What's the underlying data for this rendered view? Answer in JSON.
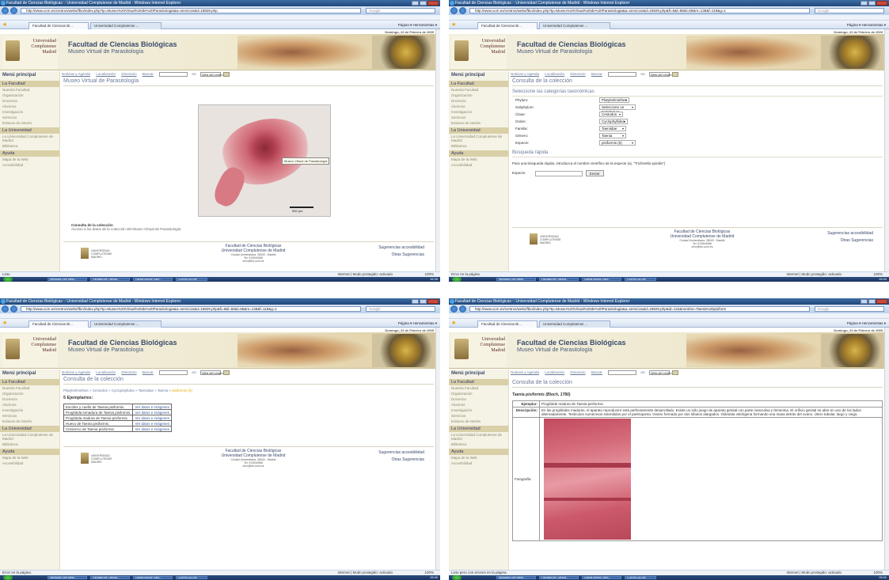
{
  "browser": {
    "window_title": "Facultad de Ciencias Biológicas :: Universidad Complutense de Madrid - Windows Internet Explorer",
    "search_placeholder": "Google",
    "tab1": "Facultad de Ciencias Bi...",
    "tab2": "Universidad Complutense ...",
    "cmd": "Página ▾  Herramientas ▾",
    "taskbar": [
      "Windows Live Mess...",
      "Facultad de Ciencia...",
      "Garcia Muñoz Garc...",
      "CURRICULUM"
    ]
  },
  "quadrants": [
    {
      "url": "http://www.ucm.es/centros/webs/fbio/index.php?tp=Museo%20Virtual%20de%20Parasitologia&a=servicios&d=18828.php",
      "status": "Listo",
      "zone": "Internet | Modo protegido: activado",
      "zoom": "100%",
      "clock": "15:39"
    },
    {
      "url": "http://www.ucm.es/centros/webs/fbio/index.php?tp=Museo%20Virtual%20de%20Parasitologia&a=servicios&d=18829.php&fi=8&l=58&l=68&m=138&f=118&g=1",
      "status": "Error en la página.",
      "zone": "Internet | Modo protegido: activado",
      "zoom": "100%",
      "clock": "15:40"
    },
    {
      "url": "http://www.ucm.es/centros/webs/fbio/index.php?tp=Museo%20Virtual%20de%20Parasitologia&a=servicios&d=18829.php&fi=8&l=58&l=68&m=138&f=118&g=1",
      "status": "Error en la página.",
      "zone": "Internet | Modo protegido: activado",
      "zoom": "100%",
      "clock": "15:40"
    },
    {
      "url": "http://www.ucm.es/centros/webs/fbio/index.php?tp=Museo%20Virtual%20de%20Parasitologia&a=servicios&d=18829.php&id=134&nombre=Taenia%20pisiform",
      "status": "Listo pero con errores en la página.",
      "zone": "Internet | Modo protegido: activado",
      "zoom": "100%",
      "clock": "15:41"
    }
  ],
  "site": {
    "date": "Domingo, 22 de Febrero de 2009",
    "university": "Universidad Complutense Madrid",
    "faculty": "Facultad de Ciencias Biológicas",
    "museum": "Museo Virtual de Parasitología",
    "subnav": [
      "Noticias y Agenda",
      "Localización",
      "Directorio",
      "Buscar"
    ],
    "subnav_scope": "en:",
    "subnav_select": "Web del centro ▾",
    "sidebar": {
      "title": "Menú principal",
      "sections": [
        {
          "name": "La Facultad",
          "items": [
            "Nuestra Facultad",
            "Organización",
            "Docencia",
            "Alumnos",
            "Investigación",
            "Servicios",
            "Enlaces de interés"
          ]
        },
        {
          "name": "La Universidad",
          "items": [
            "La Universidad Complutense de Madrid",
            "Biblioteca"
          ]
        },
        {
          "name": "Ayuda",
          "items": [
            "Mapa de la Web",
            "Accesibilidad"
          ]
        }
      ]
    },
    "footer": {
      "logo": "UNIVERSIDAD COMPLUTENSE MADRID",
      "l1": "Facultad de Ciencias Biológicas",
      "l2": "Universidad Complutense de Madrid",
      "l3": "Ciudad Universitaria. 28040 - Madrid",
      "l4": "Tel. 913944966",
      "l5": "cfco@bio.ucm.es",
      "right1": "Sugerencias accesibilidad",
      "right2": "Otras Sugerencias"
    }
  },
  "page1": {
    "heading": "Museo Virtual de Parasitología",
    "tooltip": "Museo Virtual de Parasitología",
    "scale": "500 µm",
    "consulta_title": "Consulta de la colección",
    "consulta_text": "Acceso a los datos de la colección del Museo Virtual de Parasitología"
  },
  "page2": {
    "heading": "Consulta de la colección",
    "sub": "Seleccione las categorías taxonómicas",
    "fields": [
      {
        "label": "Phylum:",
        "value": "Platyhelminthes"
      },
      {
        "label": "Subphylum:",
        "value": "Seleccione un Subphylum"
      },
      {
        "label": "Clase:",
        "value": "Cestodos"
      },
      {
        "label": "Orden:",
        "value": "Cyclophyllidea"
      },
      {
        "label": "Familia:",
        "value": "Taeniidae"
      },
      {
        "label": "Género:",
        "value": "Taenia"
      },
      {
        "label": "Especie:",
        "value": "pisiformis (5)"
      }
    ],
    "quick_title": "Búsqueda rápida",
    "quick_text": "Para una búsqueda rápida, introduzca el nombre científico de la especie (ej. \"Trichinella spiralis\")",
    "quick_label": "Especie:",
    "quick_button": "Enviar"
  },
  "page3": {
    "heading": "Consulta de la colección",
    "crumbs": "Platyhelminthes » Cestodos » Cyclophyllidea » Taeniidae » Taenia » ",
    "crumbs_last": "pisiformis (5)",
    "count": "5 Ejemplar/es:",
    "rows": [
      {
        "name": "Escólex y cuello de Taenia pisiformis.",
        "link": "Ver datos e imágenes"
      },
      {
        "name": "Proglótida inmadura de Taenia pisiformis.",
        "link": "Ver datos e imágenes"
      },
      {
        "name": "Proglótida madura de Taenia pisiformis.",
        "link": "Ver datos e imágenes"
      },
      {
        "name": "Huevo de Taenia pisiformis.",
        "link": "Ver datos e imágenes"
      },
      {
        "name": "Cisticerco de Taenia pisiformis.",
        "link": "Ver datos e imágenes"
      }
    ]
  },
  "page4": {
    "heading": "Consulta de la colección",
    "species": "Taenia pisiformis (Bloch, 1780)",
    "k_ejemplar": "Ejemplar:",
    "v_ejemplar": "Proglótide madura de Taenia pisiformis.",
    "k_desc": "Descripción:",
    "v_desc": "En las proglótides maduras, el aparato reproductor está perfectamente desarrollado. Existe un sólo juego de aparato genital con parte masculina y femenina. El orificio genital se abre en uno de los lados alternadamente. Testículos numerosos extendidos por el parénquima. Ovario formado por dos lóbulos alargados. Glándula vitelógena formando una masa detrás del ovario. Útero tubular, largo y ciego.",
    "k_foto": "Fotografía"
  }
}
